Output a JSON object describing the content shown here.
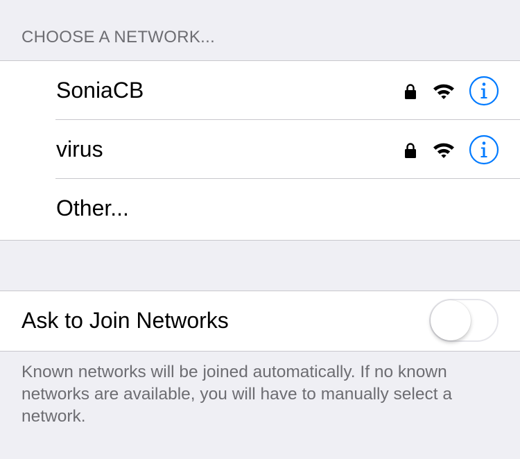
{
  "section_header": "CHOOSE A NETWORK...",
  "networks": [
    {
      "name": "SoniaCB",
      "secured": true,
      "signal_bars": 3,
      "icons": [
        "lock-icon",
        "wifi-icon",
        "info-icon"
      ]
    },
    {
      "name": "virus",
      "secured": true,
      "signal_bars": 3,
      "icons": [
        "lock-icon",
        "wifi-icon",
        "info-icon"
      ]
    }
  ],
  "other_label": "Other...",
  "ask_to_join": {
    "label": "Ask to Join Networks",
    "enabled": false
  },
  "footer_text": "Known networks will be joined automatically. If no known networks are available, you will have to manually select a network.",
  "colors": {
    "background": "#efeff4",
    "info_blue": "#007aff",
    "secondary_text": "#6d6d72",
    "separator": "#c8c7cc"
  }
}
